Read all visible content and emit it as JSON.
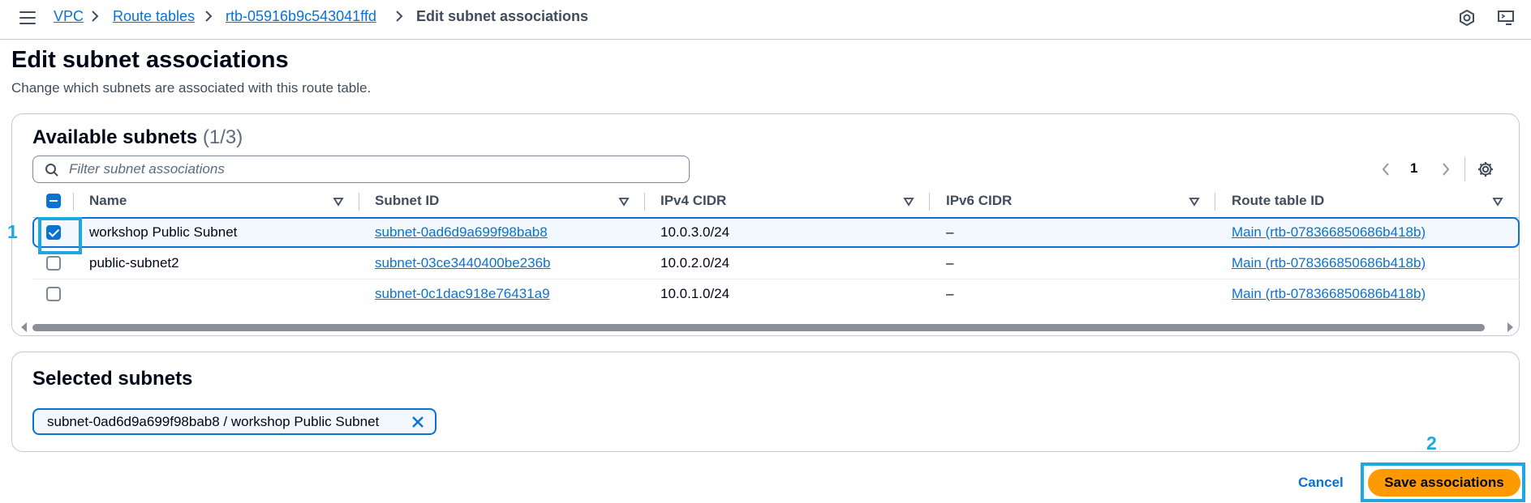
{
  "breadcrumb": {
    "items": [
      "VPC",
      "Route tables",
      "rtb-05916b9c543041ffd",
      "Edit subnet associations"
    ]
  },
  "page": {
    "title": "Edit subnet associations",
    "description": "Change which subnets are associated with this route table."
  },
  "available_subnets": {
    "heading": "Available subnets",
    "count": "(1/3)",
    "filter_placeholder": "Filter subnet associations",
    "current_page": "1",
    "columns": [
      "Name",
      "Subnet ID",
      "IPv4 CIDR",
      "IPv6 CIDR",
      "Route table ID"
    ],
    "rows": [
      {
        "checked": true,
        "name": "workshop Public Subnet",
        "subnet_id": "subnet-0ad6d9a699f98bab8",
        "ipv4": "10.0.3.0/24",
        "ipv6": "–",
        "route_table": "Main (rtb-078366850686b418b)"
      },
      {
        "checked": false,
        "name": "public-subnet2",
        "subnet_id": "subnet-03ce3440400be236b",
        "ipv4": "10.0.2.0/24",
        "ipv6": "–",
        "route_table": "Main (rtb-078366850686b418b)"
      },
      {
        "checked": false,
        "name": "",
        "subnet_id": "subnet-0c1dac918e76431a9",
        "ipv4": "10.0.1.0/24",
        "ipv6": "–",
        "route_table": "Main (rtb-078366850686b418b)"
      }
    ]
  },
  "selected_subnets": {
    "heading": "Selected subnets",
    "tokens": [
      "subnet-0ad6d9a699f98bab8 / workshop Public Subnet"
    ]
  },
  "actions": {
    "cancel_label": "Cancel",
    "save_label": "Save associations"
  },
  "annotations": {
    "first": "1",
    "second": "2"
  },
  "colors": {
    "link": "#0972d3",
    "primary_button": "#ff9900",
    "annotation": "#1ea7e1"
  },
  "icons": [
    "hamburger-icon",
    "chevron-right-icon",
    "cloudshell-icon",
    "console-toolbar-icon",
    "search-icon",
    "chevron-left-icon",
    "gear-icon",
    "sort-down-icon",
    "close-icon"
  ]
}
